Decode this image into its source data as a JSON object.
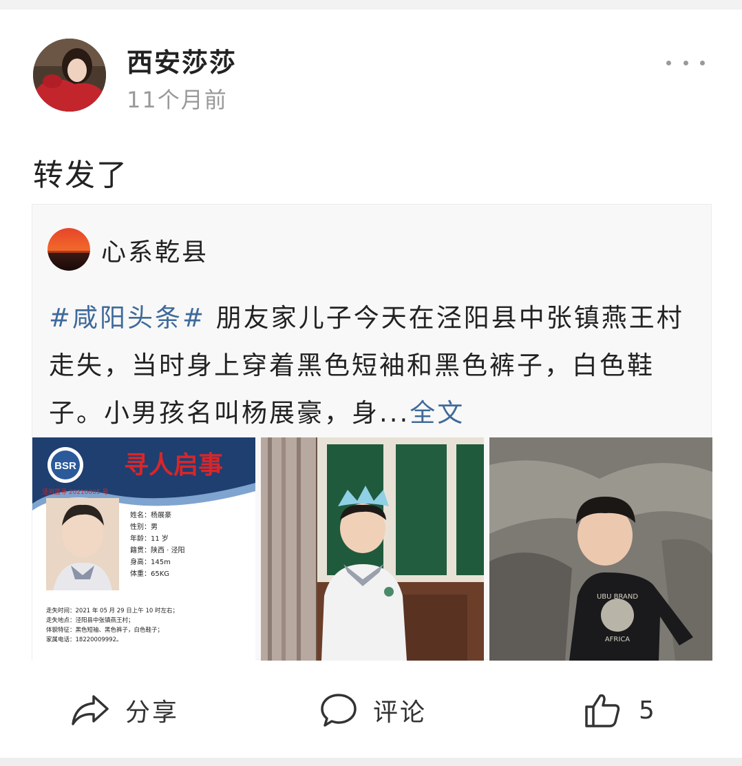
{
  "post": {
    "author": "西安莎莎",
    "time": "11个月前",
    "text": "转发了"
  },
  "repost": {
    "source_name": "心系乾县",
    "hashtag": "#咸阳头条#",
    "body": " 朋友家儿子今天在泾阳县中张镇燕王村走失，当时身上穿着黑色短袖和黑色裤子，白色鞋子。小男孩名叫杨展豪，身...",
    "full_text_link": "全文"
  },
  "poster": {
    "logo": "BSR",
    "title": "寻人启事",
    "case_no": "泾河蓝寻 20210005 号",
    "fields": [
      "姓名：杨展豪",
      "性别：男",
      "年龄：11 岁",
      "籍贯：陕西 · 泾阳",
      "身高：145m",
      "体重：65KG"
    ],
    "details": [
      "走失时间：2021 年 05 月 29 日上午 10 时左右；",
      "走失地点：泾阳县中张镇燕王村；",
      "体貌特征：黑色短袖、黑色裤子，白色鞋子；",
      "家属电话：18220009992。"
    ]
  },
  "actions": {
    "share": "分享",
    "comment": "评论",
    "like_count": "5"
  },
  "icons": {
    "share": "share-arrow-icon",
    "comment": "speech-bubble-icon",
    "like": "thumbs-up-icon",
    "more": "more-dots-icon"
  },
  "colors": {
    "link": "#3f6a9a",
    "poster_title": "#d8262a",
    "poster_banner": "#1e3f70"
  }
}
